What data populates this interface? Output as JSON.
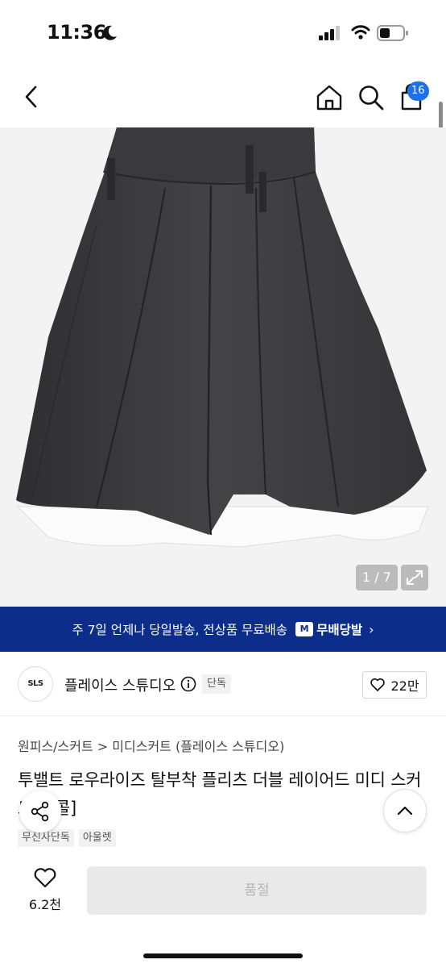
{
  "status_bar": {
    "time": "11:36"
  },
  "nav": {
    "cart_count": "16"
  },
  "gallery": {
    "counter": "1 / 7"
  },
  "banner": {
    "text": "주 7일 언제나 당일발송, 전상품 무료배송",
    "logo_mark": "M",
    "logo_text": "무배당발",
    "chevron": "›"
  },
  "brand": {
    "logo_text": "SLS",
    "name": "플레이스 스튜디오",
    "badge": "단독",
    "likes": "22만"
  },
  "product": {
    "breadcrumb": "원피스/스커트 > 미디스커트 (플레이스 스튜디오)",
    "title": "투밸트 로우라이즈 탈부착 플리츠 더블 레이어드 미디 스커트[차콜]",
    "tags": [
      "무신사단독",
      "아울렛"
    ]
  },
  "bottom_bar": {
    "wishlist_count": "6.2천",
    "soldout_label": "품절"
  },
  "colors": {
    "accent": "#1f6fe5",
    "banner_bg": "#0c2e8a",
    "skirt": "#3a3a3c"
  }
}
